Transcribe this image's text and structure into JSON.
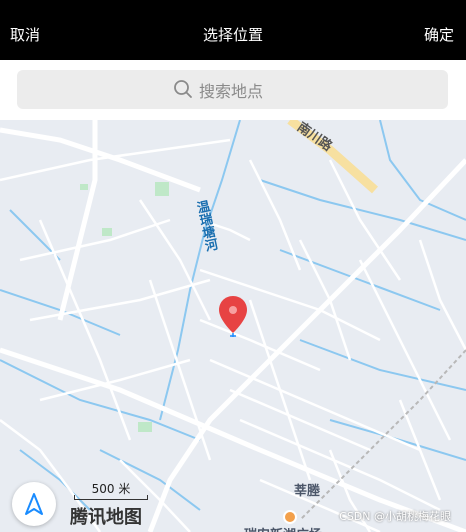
{
  "header": {
    "cancel_label": "取消",
    "title": "选择位置",
    "confirm_label": "确定"
  },
  "search": {
    "placeholder": "搜索地点"
  },
  "map": {
    "road_labels": [
      "南川路",
      "温瑞塘河"
    ],
    "poi_labels": [
      "莘塍",
      "瑞安新湖广场"
    ],
    "scale_label": "500 米",
    "brand_label": "腾讯地图",
    "watermark": "CSDN @小胡桃梅花眼",
    "colors": {
      "background": "#e8ecf2",
      "road": "#ffffff",
      "water": "#8cc8f0",
      "highway": "#f7e0a0",
      "marker": "#e74343",
      "accent": "#1a8cff"
    },
    "icons": {
      "search": "search-icon",
      "marker": "location-pin-icon",
      "locate": "navigation-arrow-icon"
    }
  }
}
